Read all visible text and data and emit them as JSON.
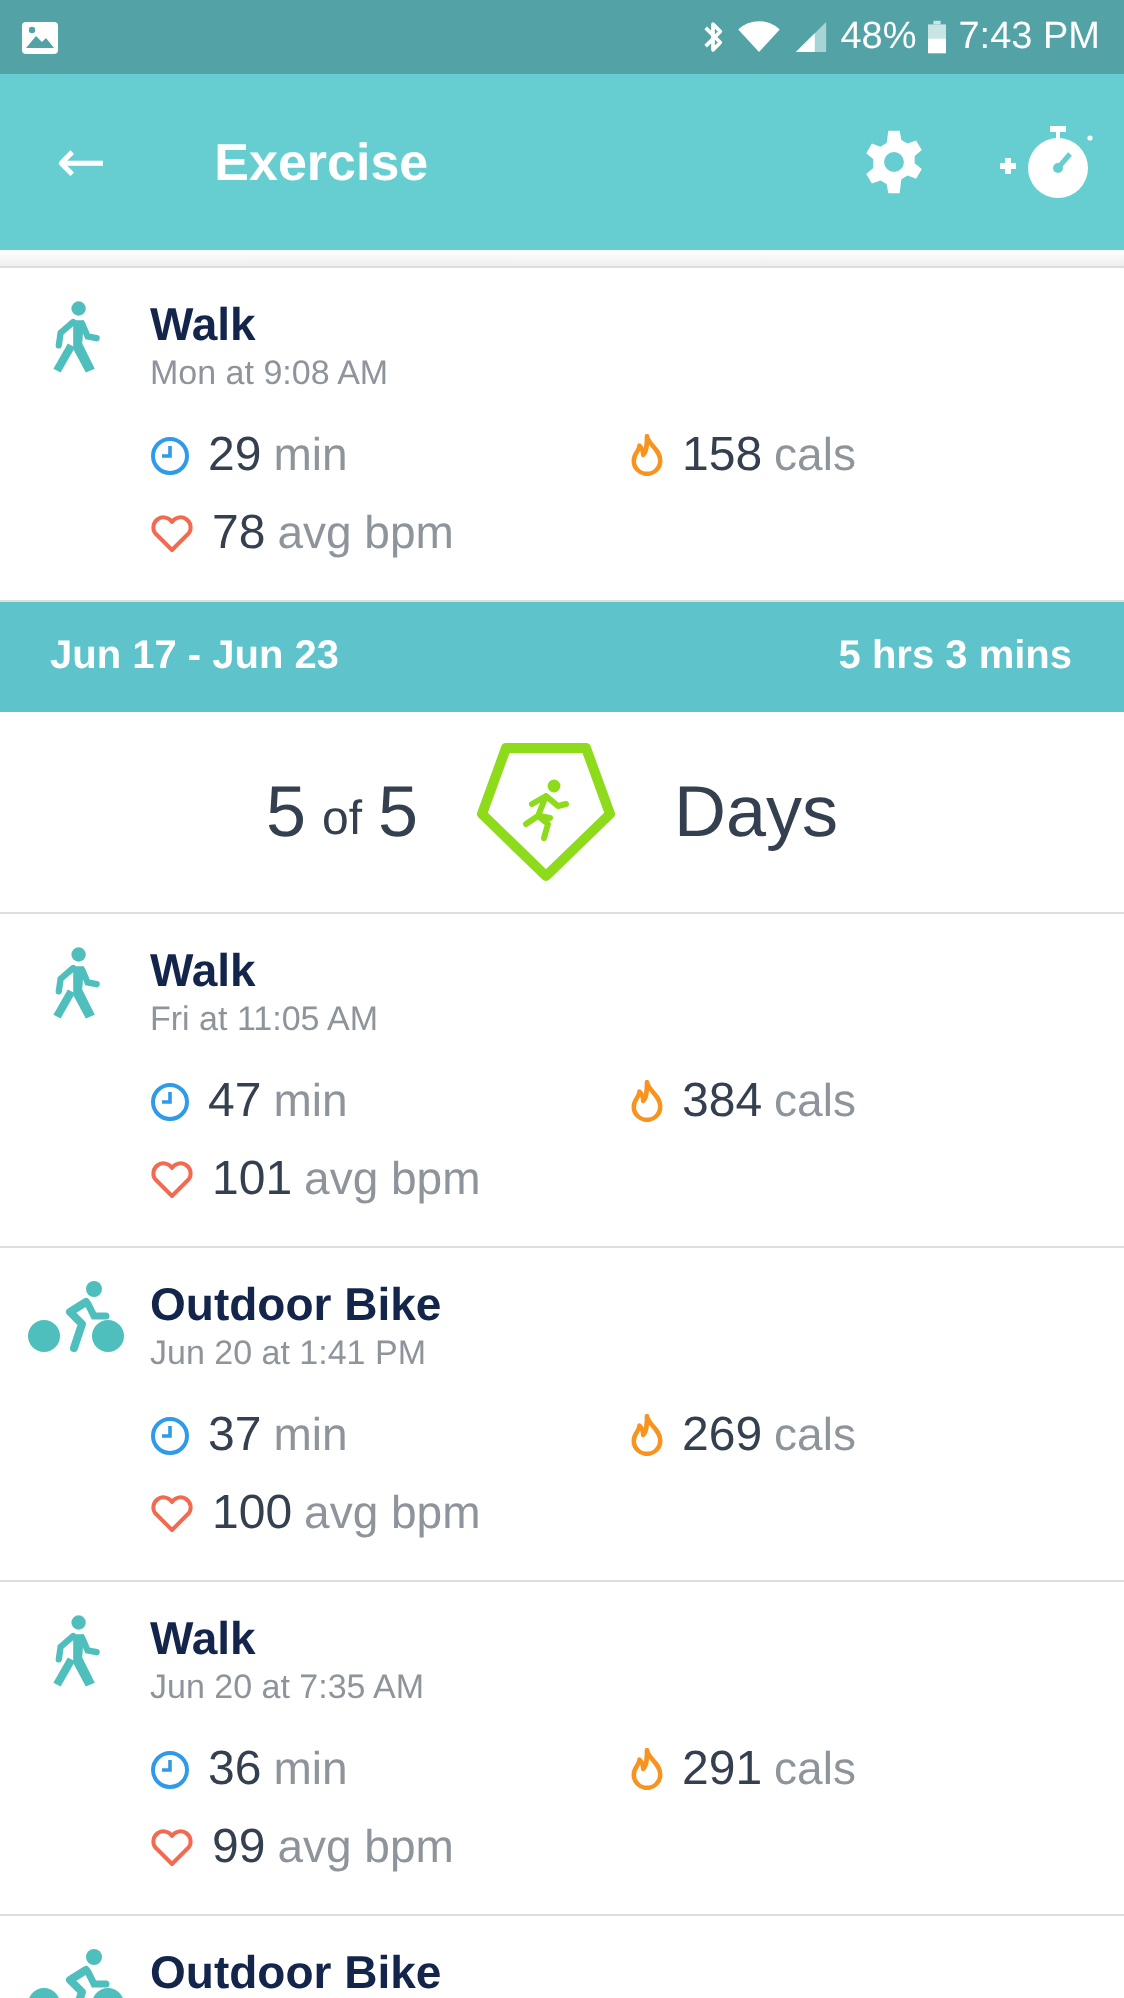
{
  "status_bar": {
    "battery": "48%",
    "time": "7:43 PM"
  },
  "app_bar": {
    "back": "←",
    "title": "Exercise"
  },
  "sections": [
    {
      "kind": "entries",
      "entries": [
        {
          "kind": "walk",
          "title": "Walk",
          "time": "Mon at 9:08 AM",
          "duration": "29",
          "duration_unit": "min",
          "calories": "158",
          "calories_unit": "cals",
          "bpm": "78",
          "bpm_unit": "avg bpm"
        }
      ]
    },
    {
      "kind": "week",
      "range": "Jun 17 - Jun 23",
      "total": "5 hrs 3 mins",
      "goal": {
        "count": "5",
        "of": "of",
        "target": "5",
        "label": "Days"
      }
    },
    {
      "kind": "entries",
      "entries": [
        {
          "kind": "walk",
          "title": "Walk",
          "time": "Fri at 11:05 AM",
          "duration": "47",
          "duration_unit": "min",
          "calories": "384",
          "calories_unit": "cals",
          "bpm": "101",
          "bpm_unit": "avg bpm"
        },
        {
          "kind": "bike",
          "title": "Outdoor Bike",
          "time": "Jun 20 at 1:41 PM",
          "duration": "37",
          "duration_unit": "min",
          "calories": "269",
          "calories_unit": "cals",
          "bpm": "100",
          "bpm_unit": "avg bpm"
        },
        {
          "kind": "walk",
          "title": "Walk",
          "time": "Jun 20 at 7:35 AM",
          "duration": "36",
          "duration_unit": "min",
          "calories": "291",
          "calories_unit": "cals",
          "bpm": "99",
          "bpm_unit": "avg bpm"
        },
        {
          "kind": "bike",
          "title": "Outdoor Bike"
        }
      ]
    }
  ]
}
